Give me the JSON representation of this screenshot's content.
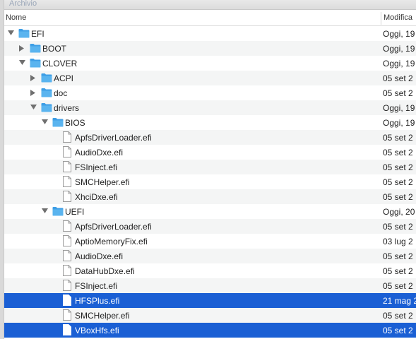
{
  "tab": {
    "label": "Archivio"
  },
  "columns": {
    "name": "Nome",
    "modified": "Modifica"
  },
  "rows": [
    {
      "name": "EFI",
      "type": "folder",
      "level": 0,
      "disclosure": "open",
      "date": "Oggi, 19",
      "alt": false,
      "selected": false
    },
    {
      "name": "BOOT",
      "type": "folder",
      "level": 1,
      "disclosure": "closed",
      "date": "Oggi, 19",
      "alt": true,
      "selected": false
    },
    {
      "name": "CLOVER",
      "type": "folder",
      "level": 1,
      "disclosure": "open",
      "date": "Oggi, 19",
      "alt": false,
      "selected": false
    },
    {
      "name": "ACPI",
      "type": "folder",
      "level": 2,
      "disclosure": "closed",
      "date": "05 set 2",
      "alt": true,
      "selected": false
    },
    {
      "name": "doc",
      "type": "folder",
      "level": 2,
      "disclosure": "closed",
      "date": "05 set 2",
      "alt": false,
      "selected": false
    },
    {
      "name": "drivers",
      "type": "folder",
      "level": 2,
      "disclosure": "open",
      "date": "Oggi, 19",
      "alt": true,
      "selected": false
    },
    {
      "name": "BIOS",
      "type": "folder",
      "level": 3,
      "disclosure": "open",
      "date": "Oggi, 19",
      "alt": false,
      "selected": false
    },
    {
      "name": "ApfsDriverLoader.efi",
      "type": "file",
      "level": 4,
      "disclosure": "none",
      "date": "05 set 2",
      "alt": true,
      "selected": false
    },
    {
      "name": "AudioDxe.efi",
      "type": "file",
      "level": 4,
      "disclosure": "none",
      "date": "05 set 2",
      "alt": false,
      "selected": false
    },
    {
      "name": "FSInject.efi",
      "type": "file",
      "level": 4,
      "disclosure": "none",
      "date": "05 set 2",
      "alt": true,
      "selected": false
    },
    {
      "name": "SMCHelper.efi",
      "type": "file",
      "level": 4,
      "disclosure": "none",
      "date": "05 set 2",
      "alt": false,
      "selected": false
    },
    {
      "name": "XhciDxe.efi",
      "type": "file",
      "level": 4,
      "disclosure": "none",
      "date": "05 set 2",
      "alt": true,
      "selected": false
    },
    {
      "name": "UEFI",
      "type": "folder",
      "level": 3,
      "disclosure": "open",
      "date": "Oggi, 20",
      "alt": false,
      "selected": false
    },
    {
      "name": "ApfsDriverLoader.efi",
      "type": "file",
      "level": 4,
      "disclosure": "none",
      "date": "05 set 2",
      "alt": true,
      "selected": false
    },
    {
      "name": "AptioMemoryFix.efi",
      "type": "file",
      "level": 4,
      "disclosure": "none",
      "date": "03 lug 2",
      "alt": false,
      "selected": false
    },
    {
      "name": "AudioDxe.efi",
      "type": "file",
      "level": 4,
      "disclosure": "none",
      "date": "05 set 2",
      "alt": true,
      "selected": false
    },
    {
      "name": "DataHubDxe.efi",
      "type": "file",
      "level": 4,
      "disclosure": "none",
      "date": "05 set 2",
      "alt": false,
      "selected": false
    },
    {
      "name": "FSInject.efi",
      "type": "file",
      "level": 4,
      "disclosure": "none",
      "date": "05 set 2",
      "alt": true,
      "selected": false
    },
    {
      "name": "HFSPlus.efi",
      "type": "file",
      "level": 4,
      "disclosure": "none",
      "date": "21 mag 2",
      "alt": false,
      "selected": true
    },
    {
      "name": "SMCHelper.efi",
      "type": "file",
      "level": 4,
      "disclosure": "none",
      "date": "05 set 2",
      "alt": true,
      "selected": false
    },
    {
      "name": "VBoxHfs.efi",
      "type": "file",
      "level": 4,
      "disclosure": "none",
      "date": "05 set 2",
      "alt": false,
      "selected": true
    }
  ],
  "colors": {
    "selection": "#1a5fd4",
    "folder": "#5ab4ef",
    "alt_row": "#f4f5f5"
  }
}
